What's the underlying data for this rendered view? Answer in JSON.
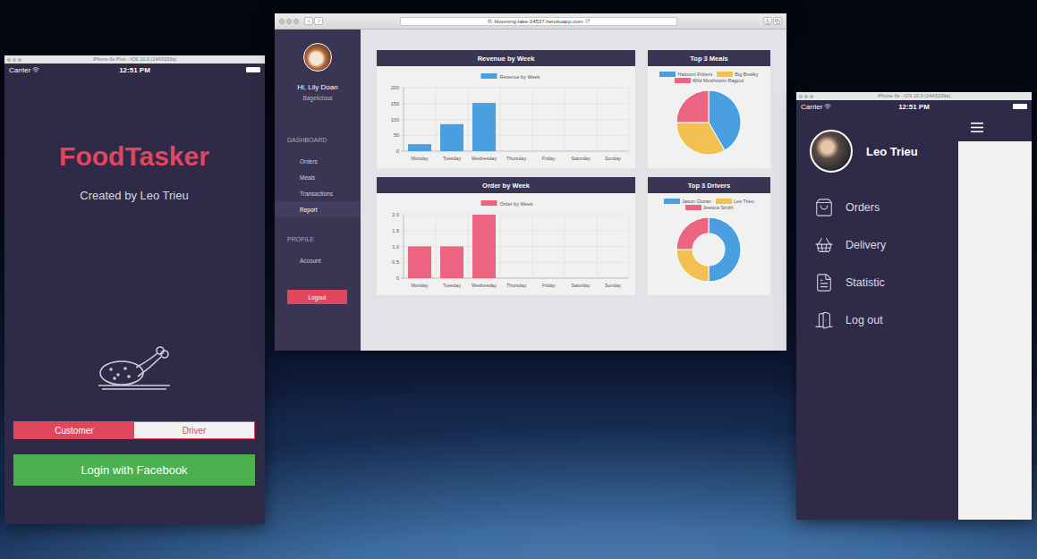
{
  "phone_left": {
    "title": "iPhone 6s Plus - iOS 10.0 (14A5339a)",
    "carrier": "Carrier",
    "time": "12:51 PM",
    "app_title": "FoodTasker",
    "subtitle": "Created by Leo Trieu",
    "roles": [
      {
        "label": "Customer",
        "selected": true
      },
      {
        "label": "Driver",
        "selected": false
      }
    ],
    "login_button": "Login with Facebook"
  },
  "browser": {
    "url": "blooming-lake-34537.herokuapp.com",
    "sidebar": {
      "greeting": "Hi, Lily Doan",
      "restaurant": "Bagelicious",
      "sections": [
        {
          "title": "DASHBOARD",
          "items": [
            {
              "label": "Orders",
              "selected": false
            },
            {
              "label": "Meals",
              "selected": false
            },
            {
              "label": "Transactions",
              "selected": false
            },
            {
              "label": "Report",
              "selected": true
            }
          ]
        },
        {
          "title": "PROFILE",
          "items": [
            {
              "label": "Account",
              "selected": false
            }
          ]
        }
      ],
      "logout": "Logout"
    },
    "bar_charts": [
      {
        "title": "Revenue by Week",
        "legend": "Revenue by Week",
        "color": "#4a9fe0",
        "ticks": [
          "0",
          "50",
          "100",
          "150",
          "200"
        ],
        "labels": [
          "Monday",
          "Tuesday",
          "Wednesday",
          "Thursday",
          "Friday",
          "Saturday",
          "Sunday"
        ],
        "values": [
          22,
          85,
          152,
          0,
          0,
          0,
          0
        ]
      },
      {
        "title": "Order by Week",
        "legend": "Order by Week",
        "color": "#ec6580",
        "ticks": [
          "0",
          "0.5",
          "1.0",
          "1.5",
          "2.0"
        ],
        "labels": [
          "Monday",
          "Tuesday",
          "Wednesday",
          "Thursday",
          "Friday",
          "Saturday",
          "Sunday"
        ],
        "values": [
          1,
          1,
          2,
          0,
          0,
          0,
          0
        ]
      }
    ],
    "pie_charts": [
      {
        "title": "Top 3 Meals",
        "kind": "pie",
        "slices": [
          {
            "label": "Haloumi Fritters",
            "value": 5,
            "color": "#4a9fe0"
          },
          {
            "label": "Big Brekky",
            "value": 4,
            "color": "#f0c050"
          },
          {
            "label": "Wild Mushroom Ragout",
            "value": 3,
            "color": "#ec6580"
          }
        ]
      },
      {
        "title": "Top 3 Drivers",
        "kind": "doughnut",
        "slices": [
          {
            "label": "Jason Gloran",
            "value": 2,
            "color": "#4a9fe0"
          },
          {
            "label": "Leo Trieu",
            "value": 1,
            "color": "#f0c050"
          },
          {
            "label": "Jessica Smith",
            "value": 1,
            "color": "#ec6580"
          }
        ]
      }
    ]
  },
  "phone_right": {
    "title": "iPhone 6s - iOS 10.0 (14A5339a)",
    "carrier": "Carrier",
    "time": "12:51 PM",
    "user": "Leo Trieu",
    "menu": [
      {
        "label": "Orders"
      },
      {
        "label": "Delivery"
      },
      {
        "label": "Statistic"
      },
      {
        "label": "Log out"
      }
    ]
  }
}
